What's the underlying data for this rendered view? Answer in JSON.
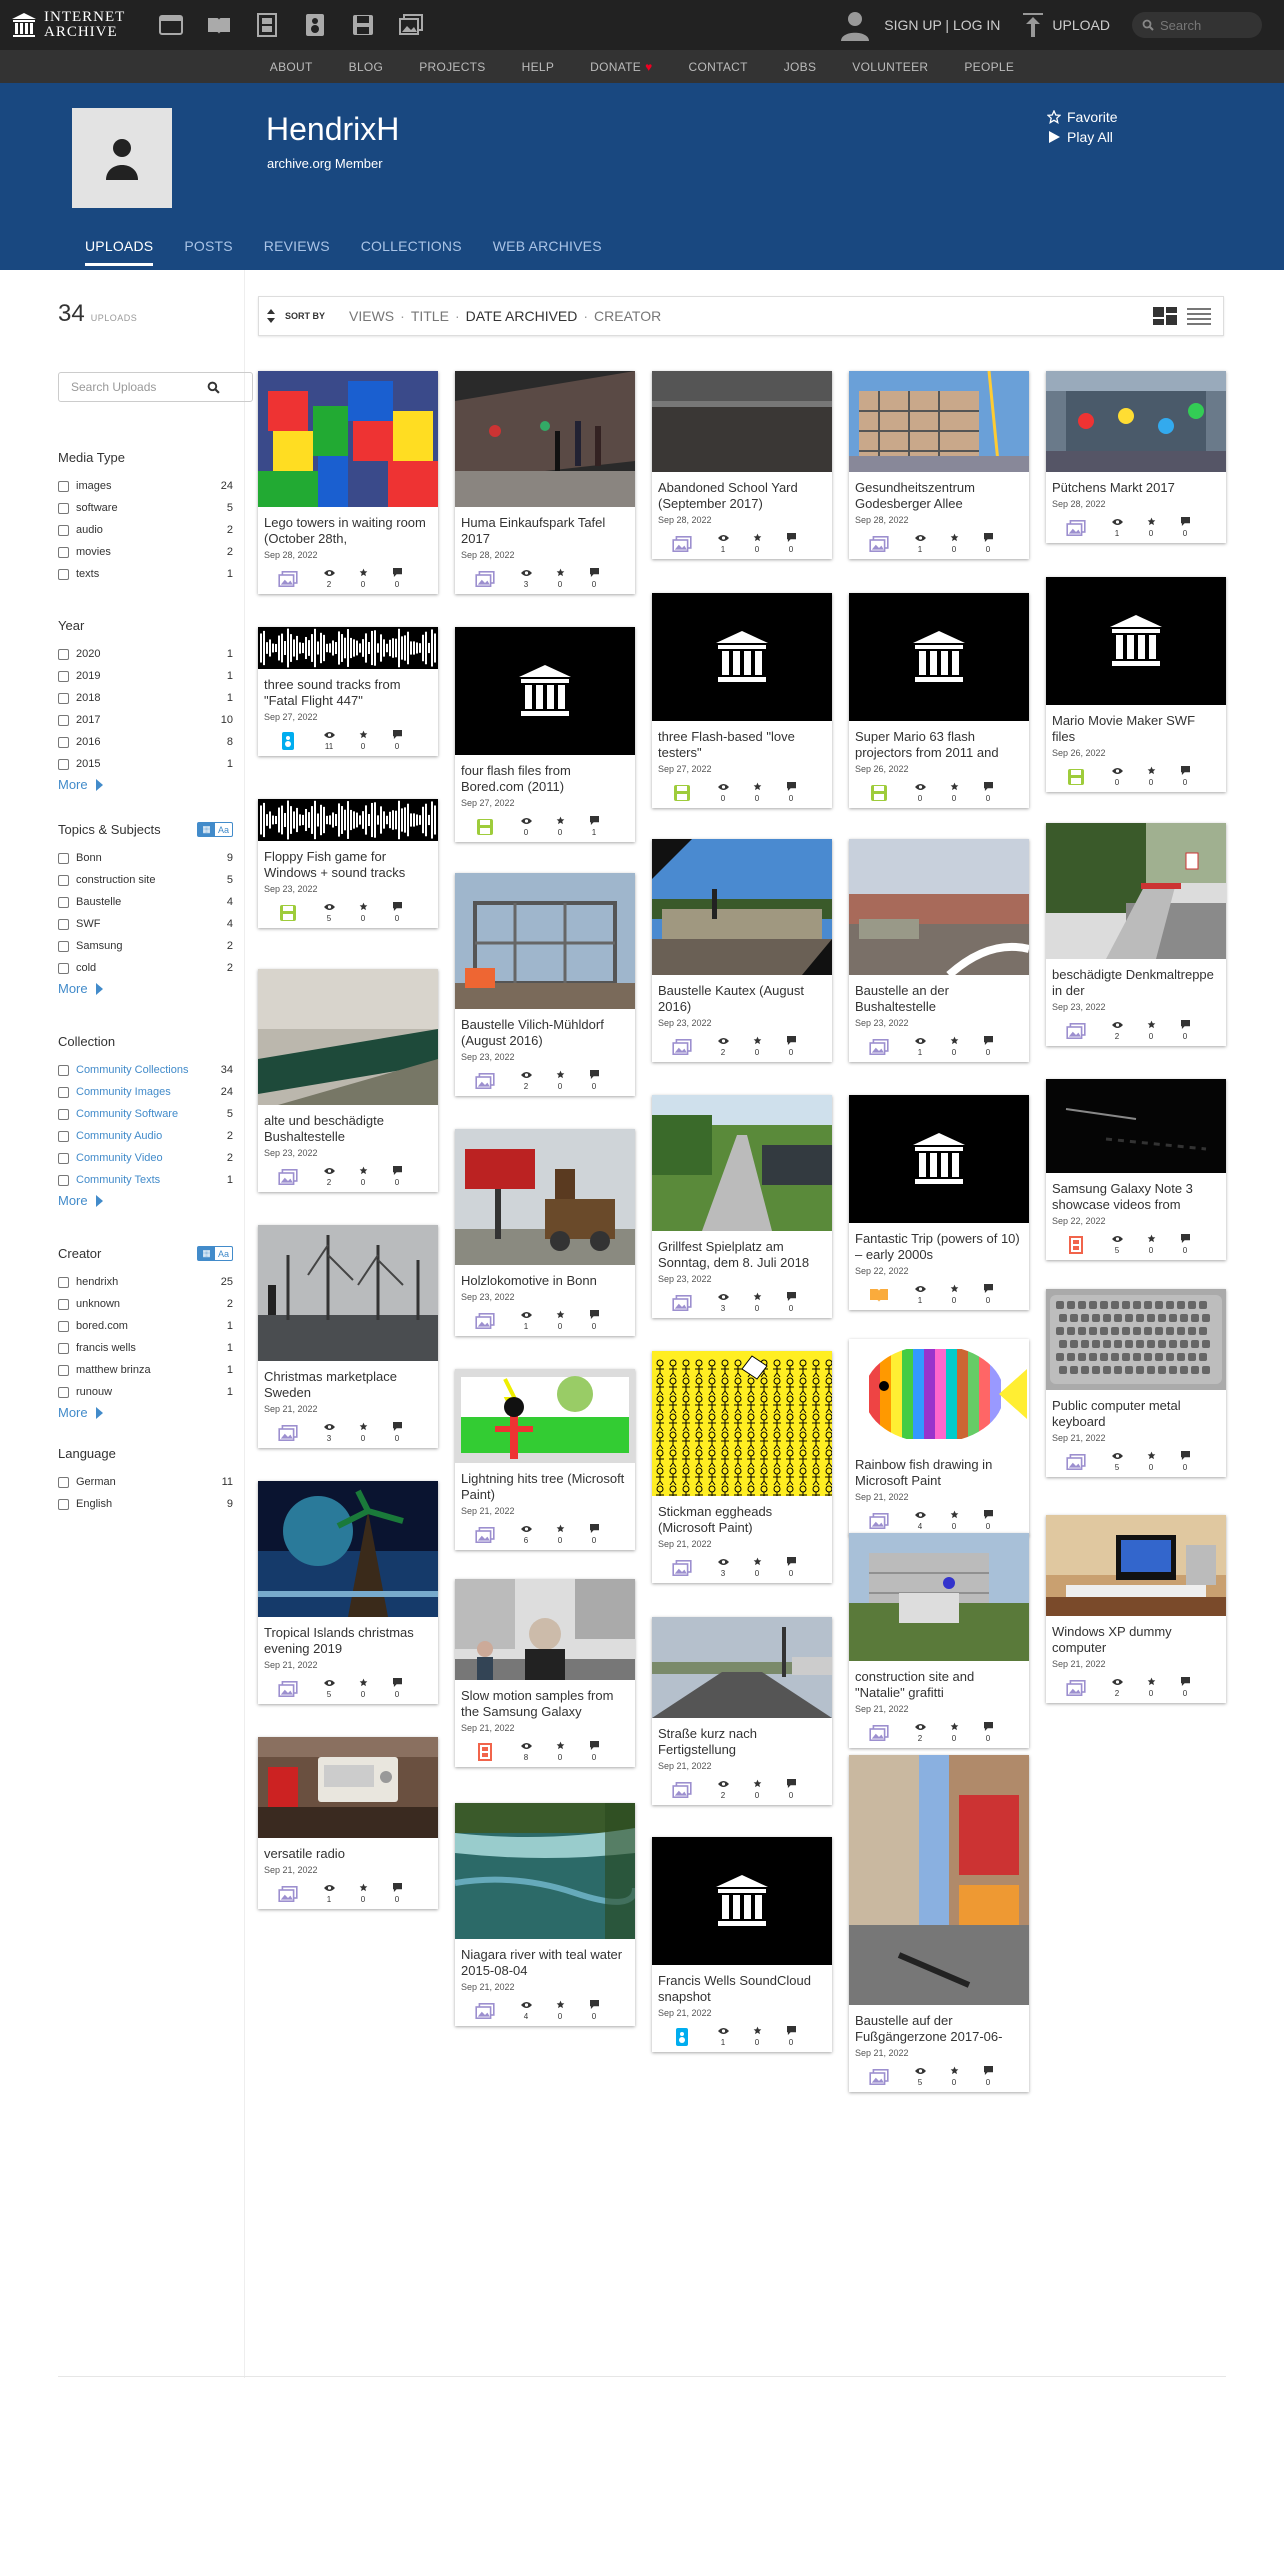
{
  "topbar": {
    "logo_line1": "INTERNET",
    "logo_line2": "ARCHIVE",
    "signup_label": "SIGN UP | LOG IN",
    "upload_label": "UPLOAD",
    "search_placeholder": "Search",
    "media_icons": [
      "web-icon",
      "texts-icon",
      "video-icon",
      "audio-icon",
      "software-icon",
      "images-icon"
    ]
  },
  "nav": {
    "items": [
      "ABOUT",
      "BLOG",
      "PROJECTS",
      "HELP",
      "DONATE",
      "CONTACT",
      "JOBS",
      "VOLUNTEER",
      "PEOPLE"
    ]
  },
  "profile": {
    "name": "HendrixH",
    "type": "archive.org Member",
    "favorite_label": "Favorite",
    "play_label": "Play All",
    "tabs": [
      "UPLOADS",
      "POSTS",
      "REVIEWS",
      "COLLECTIONS",
      "WEB ARCHIVES"
    ],
    "active_tab": "UPLOADS"
  },
  "results": {
    "count": "34",
    "count_label": "UPLOADS",
    "search_placeholder": "Search Uploads"
  },
  "sort": {
    "label": "SORT BY",
    "options": [
      "VIEWS",
      "TITLE",
      "DATE ARCHIVED",
      "CREATOR"
    ],
    "active": "DATE ARCHIVED"
  },
  "facets": [
    {
      "title": "Media Type",
      "blue": false,
      "toggle": false,
      "more": false,
      "rows": [
        {
          "label": "images",
          "count": "24"
        },
        {
          "label": "software",
          "count": "5"
        },
        {
          "label": "audio",
          "count": "2"
        },
        {
          "label": "movies",
          "count": "2"
        },
        {
          "label": "texts",
          "count": "1"
        }
      ]
    },
    {
      "title": "Year",
      "blue": false,
      "toggle": false,
      "more": true,
      "rows": [
        {
          "label": "2020",
          "count": "1"
        },
        {
          "label": "2019",
          "count": "1"
        },
        {
          "label": "2018",
          "count": "1"
        },
        {
          "label": "2017",
          "count": "10"
        },
        {
          "label": "2016",
          "count": "8"
        },
        {
          "label": "2015",
          "count": "1"
        }
      ]
    },
    {
      "title": "Topics & Subjects",
      "blue": false,
      "toggle": true,
      "more": true,
      "rows": [
        {
          "label": "Bonn",
          "count": "9"
        },
        {
          "label": "construction site",
          "count": "5"
        },
        {
          "label": "Baustelle",
          "count": "4"
        },
        {
          "label": "SWF",
          "count": "4"
        },
        {
          "label": "Samsung",
          "count": "2"
        },
        {
          "label": "cold",
          "count": "2"
        }
      ]
    },
    {
      "title": "Collection",
      "blue": true,
      "toggle": false,
      "more": true,
      "rows": [
        {
          "label": "Community Collections",
          "count": "34"
        },
        {
          "label": "Community Images",
          "count": "24"
        },
        {
          "label": "Community Software",
          "count": "5"
        },
        {
          "label": "Community Audio",
          "count": "2"
        },
        {
          "label": "Community Video",
          "count": "2"
        },
        {
          "label": "Community Texts",
          "count": "1"
        }
      ]
    },
    {
      "title": "Creator",
      "blue": false,
      "toggle": true,
      "more": true,
      "rows": [
        {
          "label": "hendrixh",
          "count": "25"
        },
        {
          "label": "unknown",
          "count": "2"
        },
        {
          "label": "bored.com",
          "count": "1"
        },
        {
          "label": "francis wells",
          "count": "1"
        },
        {
          "label": "matthew brinza",
          "count": "1"
        },
        {
          "label": "runouw",
          "count": "1"
        }
      ]
    },
    {
      "title": "Language",
      "blue": false,
      "toggle": false,
      "more": false,
      "rows": [
        {
          "label": "German",
          "count": "11"
        },
        {
          "label": "English",
          "count": "9"
        }
      ]
    }
  ],
  "more_label": "More",
  "toggle_label": "Aa",
  "items": [
    {
      "title": "Lego towers in waiting room (October 28th,",
      "date": "Sep 28, 2022",
      "type": "image",
      "views": "2",
      "favs": "0",
      "reviews": "0",
      "thumb": "lego"
    },
    {
      "title": "three sound tracks from \"Fatal Flight 447\"",
      "date": "Sep 27, 2022",
      "type": "audio",
      "views": "11",
      "favs": "0",
      "reviews": "0",
      "thumb": "wave"
    },
    {
      "title": "Floppy Fish game for Windows + sound tracks",
      "date": "Sep 23, 2022",
      "type": "software",
      "views": "5",
      "favs": "0",
      "reviews": "0",
      "thumb": "wave"
    },
    {
      "title": "alte und beschädigte Bushaltestelle",
      "date": "Sep 23, 2022",
      "type": "image",
      "views": "2",
      "favs": "0",
      "reviews": "0",
      "thumb": "bench"
    },
    {
      "title": "Christmas marketplace Sweden",
      "date": "Sep 21, 2022",
      "type": "image",
      "views": "3",
      "favs": "0",
      "reviews": "0",
      "thumb": "trees"
    },
    {
      "title": "Tropical Islands christmas evening 2019",
      "date": "Sep 21, 2022",
      "type": "image",
      "views": "5",
      "favs": "0",
      "reviews": "0",
      "thumb": "tropical"
    },
    {
      "title": "versatile radio",
      "date": "Sep 21, 2022",
      "type": "image",
      "views": "1",
      "favs": "0",
      "reviews": "0",
      "thumb": "radio"
    },
    {
      "title": "Huma Einkaufspark Tafel 2017",
      "date": "Sep 28, 2022",
      "type": "image",
      "views": "3",
      "favs": "0",
      "reviews": "0",
      "thumb": "mall"
    },
    {
      "title": "four flash files from Bored.com (2011)",
      "date": "Sep 27, 2022",
      "type": "software",
      "views": "0",
      "favs": "0",
      "reviews": "1",
      "thumb": "archive"
    },
    {
      "title": "Baustelle Vilich-Mühldorf (August 2016)",
      "date": "Sep 23, 2022",
      "type": "image",
      "views": "2",
      "favs": "0",
      "reviews": "0",
      "thumb": "site"
    },
    {
      "title": "Holzlokomotive in Bonn",
      "date": "Sep 23, 2022",
      "type": "image",
      "views": "1",
      "favs": "0",
      "reviews": "0",
      "thumb": "loco"
    },
    {
      "title": "Lightning hits tree (Microsoft Paint)",
      "date": "Sep 21, 2022",
      "type": "image",
      "views": "6",
      "favs": "0",
      "reviews": "0",
      "thumb": "paint"
    },
    {
      "title": "Slow motion samples from the Samsung Galaxy",
      "date": "Sep 21, 2022",
      "type": "movie",
      "views": "8",
      "favs": "0",
      "reviews": "0",
      "thumb": "street"
    },
    {
      "title": "Niagara river with teal water 2015-08-04",
      "date": "Sep 21, 2022",
      "type": "image",
      "views": "4",
      "favs": "0",
      "reviews": "0",
      "thumb": "river"
    },
    {
      "title": "Abandoned School Yard (September 2017)",
      "date": "Sep 28, 2022",
      "type": "image",
      "views": "1",
      "favs": "0",
      "reviews": "0",
      "thumb": "yard"
    },
    {
      "title": "three Flash-based \"love testers\"",
      "date": "Sep 27, 2022",
      "type": "software",
      "views": "0",
      "favs": "0",
      "reviews": "0",
      "thumb": "archive"
    },
    {
      "title": "Baustelle Kautex (August 2016)",
      "date": "Sep 23, 2022",
      "type": "image",
      "views": "2",
      "favs": "0",
      "reviews": "0",
      "thumb": "kautex"
    },
    {
      "title": "Grillfest Spielplatz am Sonntag, dem 8. Juli 2018",
      "date": "Sep 23, 2022",
      "type": "image",
      "views": "3",
      "favs": "0",
      "reviews": "0",
      "thumb": "road"
    },
    {
      "title": "Stickman eggheads (Microsoft Paint)",
      "date": "Sep 21, 2022",
      "type": "image",
      "views": "3",
      "favs": "0",
      "reviews": "0",
      "thumb": "stick"
    },
    {
      "title": "Straße kurz nach Fertigstellung",
      "date": "Sep 21, 2022",
      "type": "image",
      "views": "2",
      "favs": "0",
      "reviews": "0",
      "thumb": "strasse"
    },
    {
      "title": "Francis Wells SoundCloud snapshot",
      "date": "Sep 21, 2022",
      "type": "audio",
      "views": "1",
      "favs": "0",
      "reviews": "0",
      "thumb": "archive"
    },
    {
      "title": "Gesundheitszentrum Godesberger Allee",
      "date": "Sep 28, 2022",
      "type": "image",
      "views": "1",
      "favs": "0",
      "reviews": "0",
      "thumb": "scaffold"
    },
    {
      "title": "Super Mario 63 flash projectors from 2011 and",
      "date": "Sep 26, 2022",
      "type": "software",
      "views": "0",
      "favs": "0",
      "reviews": "0",
      "thumb": "archive"
    },
    {
      "title": "Baustelle an der Bushaltestelle",
      "date": "Sep 23, 2022",
      "type": "image",
      "views": "1",
      "favs": "0",
      "reviews": "0",
      "thumb": "busstop"
    },
    {
      "title": "Fantastic Trip (powers of 10) – early 2000s",
      "date": "Sep 22, 2022",
      "type": "texts",
      "views": "1",
      "favs": "0",
      "reviews": "0",
      "thumb": "archive"
    },
    {
      "title": "Rainbow fish drawing in Microsoft Paint",
      "date": "Sep 21, 2022",
      "type": "image",
      "views": "4",
      "favs": "0",
      "reviews": "0",
      "thumb": "fish"
    },
    {
      "title": "construction site and \"Natalie\" grafitti",
      "date": "Sep 21, 2022",
      "type": "image",
      "views": "2",
      "favs": "0",
      "reviews": "0",
      "thumb": "natalie"
    },
    {
      "title": "Baustelle auf der Fußgängerzone 2017-06-",
      "date": "Sep 21, 2022",
      "type": "image",
      "views": "5",
      "favs": "0",
      "reviews": "0",
      "thumb": "zone"
    },
    {
      "title": "Pütchens Markt 2017",
      "date": "Sep 28, 2022",
      "type": "image",
      "views": "1",
      "favs": "0",
      "reviews": "0",
      "thumb": "fair"
    },
    {
      "title": "Mario Movie Maker SWF files",
      "date": "Sep 26, 2022",
      "type": "software",
      "views": "0",
      "favs": "0",
      "reviews": "0",
      "thumb": "archive"
    },
    {
      "title": "beschädigte Denkmaltreppe in der",
      "date": "Sep 23, 2022",
      "type": "image",
      "views": "2",
      "favs": "0",
      "reviews": "0",
      "thumb": "stairs"
    },
    {
      "title": "Samsung Galaxy Note 3 showcase videos from",
      "date": "Sep 22, 2022",
      "type": "movie",
      "views": "5",
      "favs": "0",
      "reviews": "0",
      "thumb": "dark"
    },
    {
      "title": "Public computer metal keyboard",
      "date": "Sep 21, 2022",
      "type": "image",
      "views": "5",
      "favs": "0",
      "reviews": "0",
      "thumb": "keyboard"
    },
    {
      "title": "Windows XP dummy computer",
      "date": "Sep 21, 2022",
      "type": "image",
      "views": "2",
      "favs": "0",
      "reviews": "0",
      "thumb": "desk"
    }
  ],
  "colors": {
    "header": "#194880",
    "topbar": "#222222",
    "navbar": "#333333",
    "link": "#428bca",
    "image_icon": "#9c8fcf",
    "audio_icon": "#00adef",
    "software_icon": "#9ecc3b",
    "movie_icon": "#f1644b",
    "texts_icon": "#faab3c"
  }
}
